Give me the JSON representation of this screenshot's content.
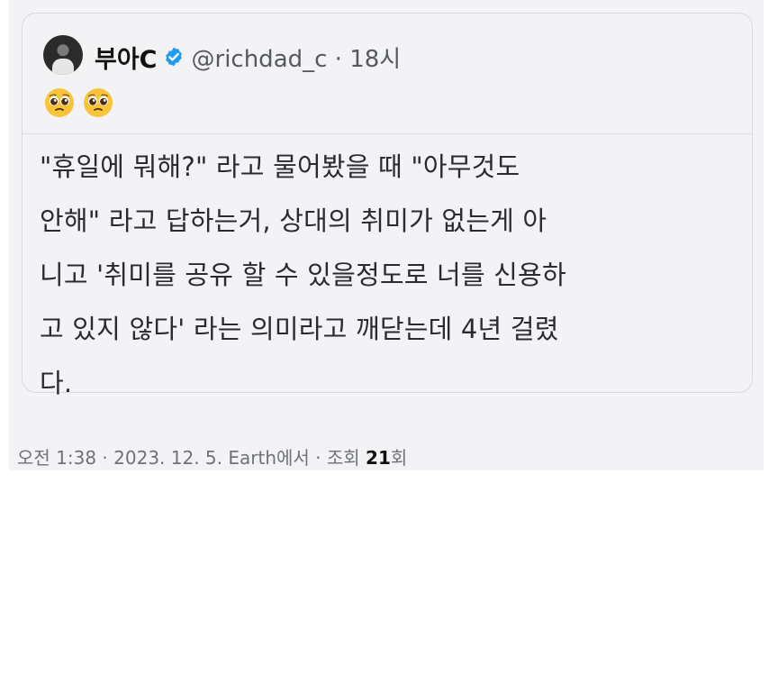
{
  "tweet": {
    "author_name": "부아C",
    "handle_time": "@richdad_c · 18시",
    "text_lines": [
      "\"휴일에 뭐해?\" 라고 물어봤을 때 \"아무것도",
      "안해\" 라고 답하는거, 상대의 취미가 없는게 아",
      "니고 '취미를 공유 할 수 있을정도로 너를 신용하",
      "고 있지 않다' 라는 의미라고 깨닫는데 4년 걸렸",
      "다."
    ]
  },
  "footer": {
    "meta": "오전 1:38 · 2023. 12. 5. Earth에서 · 조회 ",
    "views_count": "21",
    "views_suffix": "회"
  },
  "colors": {
    "background": "#f3f3f5",
    "verified_badge": "#1d9bf0",
    "emoji": "#f7c43a"
  },
  "icons": {
    "verified": "verified-badge-icon",
    "emoji": "pleading-face-emoji"
  }
}
